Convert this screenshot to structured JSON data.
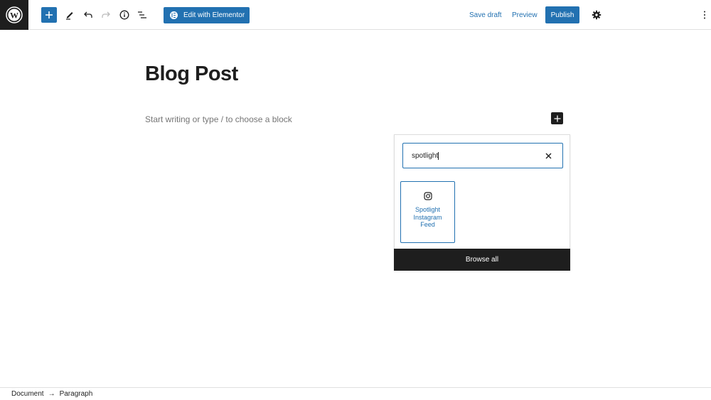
{
  "toolbar": {
    "logo": "wordpress-logo",
    "add_block": "plus-icon",
    "tools": [
      "pencil-icon",
      "undo-icon",
      "redo-icon",
      "info-icon",
      "list-view-icon"
    ],
    "elementor_label": "Edit with Elementor",
    "save_draft_label": "Save draft",
    "preview_label": "Preview",
    "publish_label": "Publish",
    "settings_icon": "gear-icon",
    "options_icon": "more-vertical-icon"
  },
  "editor": {
    "title": "Blog Post",
    "placeholder": "Start writing or type / to choose a block"
  },
  "inserter": {
    "search_value": "spotlight",
    "results": [
      {
        "icon": "instagram-icon",
        "label": "Spotlight Instagram Feed"
      }
    ],
    "browse_all_label": "Browse all"
  },
  "footer": {
    "breadcrumb": [
      "Document",
      "Paragraph"
    ],
    "separator": "→"
  },
  "colors": {
    "accent": "#2271b1",
    "dark": "#1e1e1e"
  }
}
